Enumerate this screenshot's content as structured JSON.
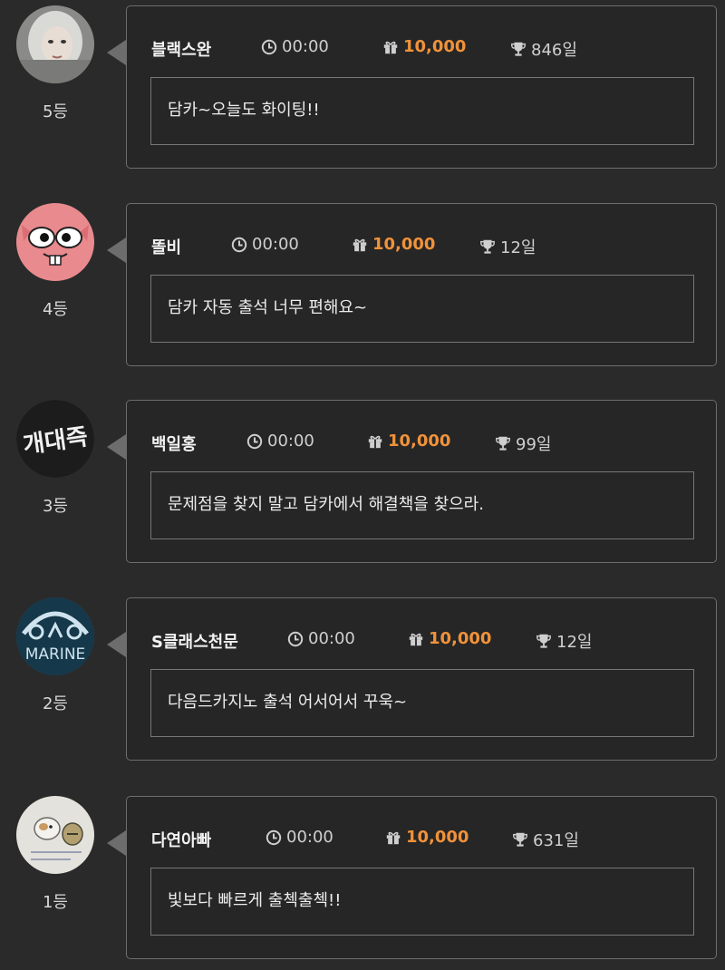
{
  "entries": [
    {
      "rank": "5등",
      "name": "블랙스완",
      "time": "00:00",
      "points": "10,000",
      "days": "846일",
      "message": "담카~오늘도 화이팅!!",
      "avatar": "photo-portrait"
    },
    {
      "rank": "4등",
      "name": "똘비",
      "time": "00:00",
      "points": "10,000",
      "days": "12일",
      "message": "담카 자동 출석 너무 편해요~",
      "avatar": "pink-cartoon-face"
    },
    {
      "rank": "3등",
      "name": "백일홍",
      "time": "00:00",
      "points": "10,000",
      "days": "99일",
      "message": "문제점을 찾지 말고 담카에서 해결책을 찾으라.",
      "avatar": "dark-neon-sign"
    },
    {
      "rank": "2등",
      "name": "S클래스천문",
      "time": "00:00",
      "points": "10,000",
      "days": "12일",
      "message": "다음드카지노 출석 어서어서 꾸욱~",
      "avatar": "marine-logo"
    },
    {
      "rank": "1등",
      "name": "다연아빠",
      "time": "00:00",
      "points": "10,000",
      "days": "631일",
      "message": "빛보다 빠르게 출첵출첵!!",
      "avatar": "hamster-drawing"
    }
  ],
  "avatar_texts": {
    "marine": "MARINE",
    "sign": "개대즉"
  },
  "icons": {
    "time": "clock-icon",
    "points": "gift-icon",
    "days": "trophy-icon"
  },
  "colors": {
    "background": "#2a2a2a",
    "points": "#f0923a",
    "border": "#6d6d6d"
  }
}
